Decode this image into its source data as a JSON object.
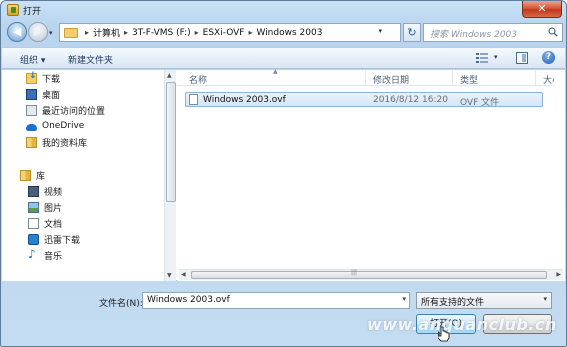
{
  "window": {
    "title": "打开",
    "close_glyph": "✕"
  },
  "nav": {
    "back_glyph": "◀",
    "forward_glyph": "▶",
    "breadcrumbs": [
      "计算机",
      "3T-F-VMS (F:)",
      "ESXi-OVF",
      "Windows 2003"
    ],
    "refresh_glyph": "↻",
    "search_placeholder": "搜索 Windows 2003"
  },
  "toolbar": {
    "organize_label": "组织 ▾",
    "new_folder_label": "新建文件夹",
    "help_glyph": "?"
  },
  "sidebar": {
    "favorites": [
      {
        "label": "下载",
        "icon": "download-icon"
      },
      {
        "label": "桌面",
        "icon": "desktop-icon"
      },
      {
        "label": "最近访问的位置",
        "icon": "recent-places-icon"
      },
      {
        "label": "OneDrive",
        "icon": "cloud-icon"
      },
      {
        "label": "我的资料库",
        "icon": "library-icon"
      }
    ],
    "libraries_label": "库",
    "libraries": [
      {
        "label": "视频",
        "icon": "video-icon"
      },
      {
        "label": "图片",
        "icon": "picture-icon"
      },
      {
        "label": "文档",
        "icon": "document-icon"
      },
      {
        "label": "迅雷下载",
        "icon": "thunder-icon"
      },
      {
        "label": "音乐",
        "icon": "music-icon"
      }
    ]
  },
  "file_list": {
    "columns": {
      "name": "名称",
      "date": "修改日期",
      "type": "类型",
      "size": "大小"
    },
    "rows": [
      {
        "name": "Windows 2003.ovf",
        "date": "2016/8/12 16:20",
        "type": "OVF 文件"
      }
    ]
  },
  "bottom": {
    "filename_label": "文件名(N):",
    "filename_value": "Windows 2003.ovf",
    "filetype_value": "所有支持的文件",
    "open_label": "打开(O)",
    "cancel_label": ""
  },
  "watermark": "www.anquanclub.cn",
  "colors": {
    "accent": "#3c7fb1",
    "selection": "#d3e6f8",
    "frame": "#c4dcf1"
  }
}
